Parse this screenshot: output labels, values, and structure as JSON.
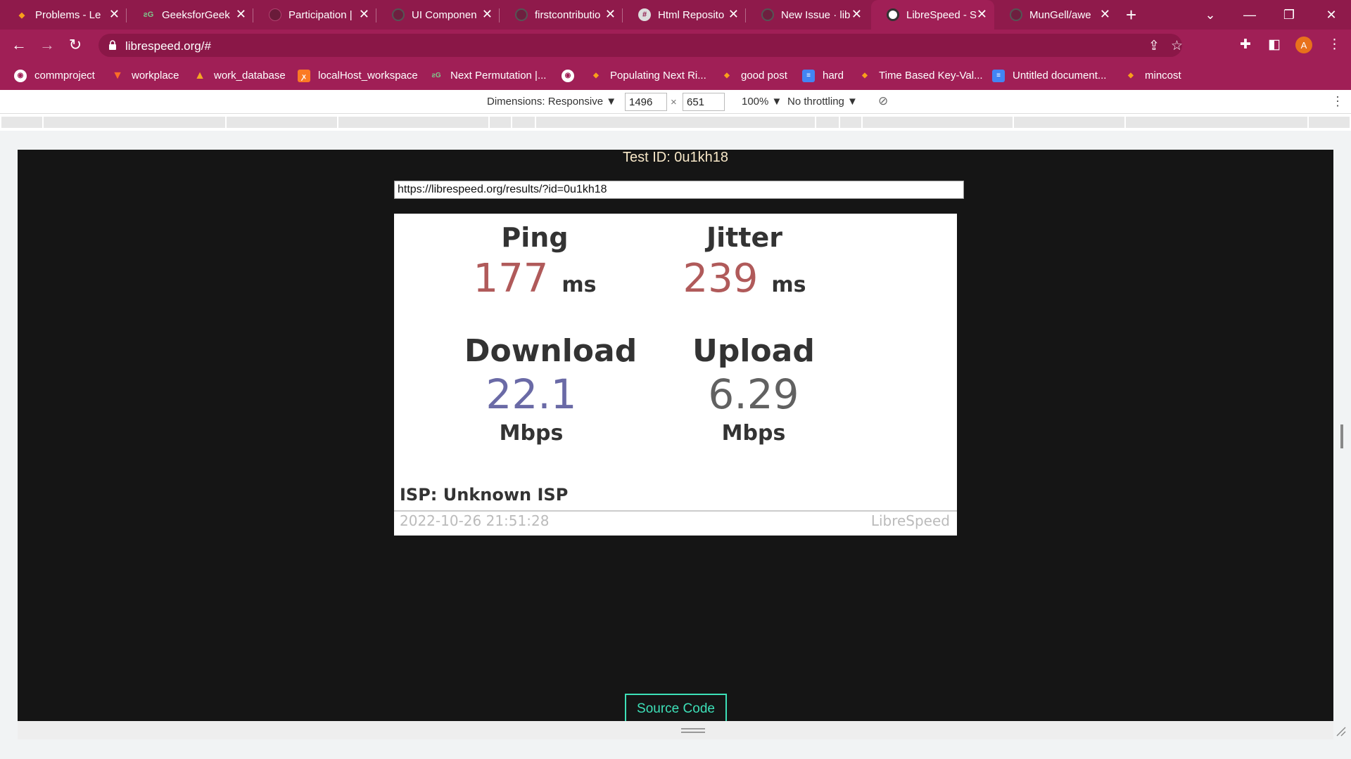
{
  "tabs": [
    {
      "title": "Problems - Le",
      "favicon": "leetcode-icon",
      "color": "#f89f1b"
    },
    {
      "title": "GeeksforGeek",
      "favicon": "geeksforgeeks-icon",
      "color": "#2f8d46"
    },
    {
      "title": "Participation |",
      "favicon": "participation-icon",
      "color": "#6a1b3a"
    },
    {
      "title": "UI Componen",
      "favicon": "github-icon",
      "color": "#444"
    },
    {
      "title": "firstcontributio",
      "favicon": "github-icon",
      "color": "#444"
    },
    {
      "title": "Html Reposito",
      "favicon": "repo-icon",
      "color": "#ddd"
    },
    {
      "title": "New Issue · lib",
      "favicon": "github-icon",
      "color": "#444"
    },
    {
      "title": "LibreSpeed - S",
      "favicon": "librespeed-icon",
      "color": "#eee"
    },
    {
      "title": "MunGell/awe",
      "favicon": "github-icon",
      "color": "#444"
    }
  ],
  "window": {
    "new_tab": "+",
    "tab_search": "⌄",
    "minimize": "—",
    "restore": "❐",
    "close": "✕"
  },
  "address_bar": {
    "url": "librespeed.org/#"
  },
  "bookmarks": [
    {
      "label": "commproject",
      "icon": "globe-icon"
    },
    {
      "label": "workplace",
      "icon": "gitlab-icon"
    },
    {
      "label": "work_database",
      "icon": "warning-icon"
    },
    {
      "label": "localHost_workspace",
      "icon": "xampp-icon"
    },
    {
      "label": "Next Permutation |...",
      "icon": "geeksforgeeks-icon"
    },
    {
      "label": "",
      "icon": "globe-icon"
    },
    {
      "label": "Populating Next Ri...",
      "icon": "leetcode-icon"
    },
    {
      "label": "good post",
      "icon": "leetcode-icon"
    },
    {
      "label": "hard",
      "icon": "docs-icon"
    },
    {
      "label": "Time Based Key-Val...",
      "icon": "leetcode-icon"
    },
    {
      "label": "Untitled document...",
      "icon": "docs-icon"
    },
    {
      "label": "mincost",
      "icon": "leetcode-icon"
    }
  ],
  "device_toolbar": {
    "dimensions": "Dimensions: Responsive ▼",
    "width": "1496",
    "x": "×",
    "height": "651",
    "zoom": "100% ▼",
    "throttling": "No throttling ▼"
  },
  "result": {
    "test_id": "Test ID: 0u1kh18",
    "share_url": "https://librespeed.org/results/?id=0u1kh18",
    "ping_label": "Ping",
    "ping_value": "177",
    "ping_unit": "ms",
    "jitter_label": "Jitter",
    "jitter_value": "239",
    "jitter_unit": "ms",
    "download_label": "Download",
    "download_value": "22.1",
    "download_unit": "Mbps",
    "upload_label": "Upload",
    "upload_value": "6.29",
    "upload_unit": "Mbps",
    "isp": "ISP: Unknown ISP",
    "timestamp": "2022-10-26 21:51:28",
    "brand": "LibreSpeed"
  },
  "source_button": "Source Code",
  "colors": {
    "browser_frame": "#a01f56",
    "page_bg": "#151515",
    "ping_color": "#b05a5a",
    "download_color": "#6a6aa6",
    "upload_color": "#616161",
    "source_button": "#3de0b8"
  }
}
